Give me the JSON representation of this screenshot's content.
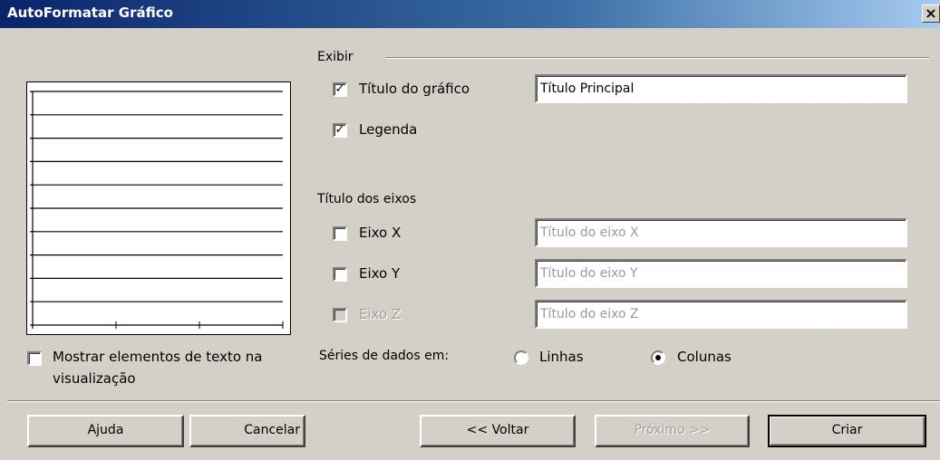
{
  "window": {
    "title": "AutoFormatar Gráfico",
    "close_label": "×"
  },
  "display": {
    "group_label": "Exibir",
    "chart_title_label": "Título do gráfico",
    "chart_title_checked": true,
    "chart_title_value": "Título Principal",
    "legend_label": "Legenda",
    "legend_checked": true
  },
  "axes": {
    "group_label": "Título dos eixos",
    "x_label": "Eixo X",
    "x_checked": false,
    "x_value": "Título do eixo X",
    "y_label": "Eixo Y",
    "y_checked": false,
    "y_value": "Título do eixo Y",
    "z_label": "Eixo Z",
    "z_checked": false,
    "z_value": "Título do eixo Z"
  },
  "preview": {
    "show_text_label_line1": "Mostrar elementos de texto na",
    "show_text_label_line2": "visualização",
    "show_text_checked": false,
    "grid_lines": 11,
    "x_ticks": 3
  },
  "series": {
    "label": "Séries de dados em:",
    "rows_label": "Linhas",
    "columns_label": "Colunas",
    "selected": "Colunas"
  },
  "buttons": {
    "help": "Ajuda",
    "cancel": "Cancelar",
    "back": "<< Voltar",
    "next": "Próximo >>",
    "create": "Criar"
  },
  "colors": {
    "title_bar": "#0a246a",
    "dialog": "#d4d0c8"
  }
}
